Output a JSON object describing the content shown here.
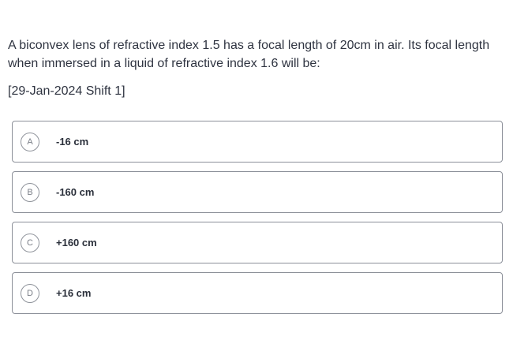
{
  "question": {
    "text": "A biconvex lens of refractive index 1.5 has a focal length of 20cm in air. Its focal length when immersed in a liquid of refractive index 1.6 will be:",
    "source": "[29-Jan-2024 Shift 1]"
  },
  "options": [
    {
      "letter": "A",
      "text": "-16 cm"
    },
    {
      "letter": "B",
      "text": "-160 cm"
    },
    {
      "letter": "C",
      "text": "+160 cm"
    },
    {
      "letter": "D",
      "text": "+16 cm"
    }
  ]
}
